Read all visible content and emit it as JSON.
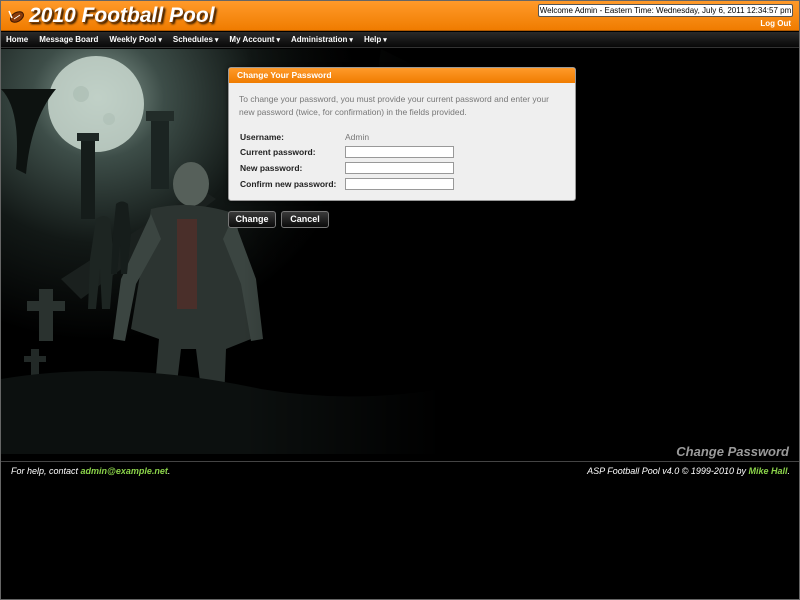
{
  "header": {
    "title": "2010 Football Pool",
    "welcome": "Welcome Admin - Eastern Time: Wednesday, July 6, 2011 12:34:57 pm",
    "logout": "Log Out",
    "logo_icon": "football-icon"
  },
  "nav": {
    "items": [
      {
        "label": "Home",
        "dropdown": false
      },
      {
        "label": "Message Board",
        "dropdown": false
      },
      {
        "label": "Weekly Pool",
        "dropdown": true
      },
      {
        "label": "Schedules",
        "dropdown": true
      },
      {
        "label": "My Account",
        "dropdown": true
      },
      {
        "label": "Administration",
        "dropdown": true
      },
      {
        "label": "Help",
        "dropdown": true
      }
    ],
    "caret": "▾"
  },
  "dialog": {
    "title": "Change Your Password",
    "description": "To change your password, you must provide your current password and enter your new password (twice, for confirmation) in the fields provided.",
    "username_label": "Username:",
    "username_value": "Admin",
    "current_label": "Current password:",
    "new_label": "New password:",
    "confirm_label": "Confirm new password:",
    "current_value": "",
    "new_value": "",
    "confirm_value": ""
  },
  "buttons": {
    "change": "Change",
    "cancel": "Cancel"
  },
  "page_caption": "Change Password",
  "footer": {
    "help_prefix": "For help, contact ",
    "help_email": "admin@example.net",
    "help_suffix": ".",
    "credit_prefix": "ASP Football Pool v4.0 © 1999-2010 by ",
    "credit_author": "Mike Hall",
    "credit_suffix": "."
  },
  "colors": {
    "accent": "#f07c00",
    "link": "#8bd34a",
    "background": "#000000"
  }
}
